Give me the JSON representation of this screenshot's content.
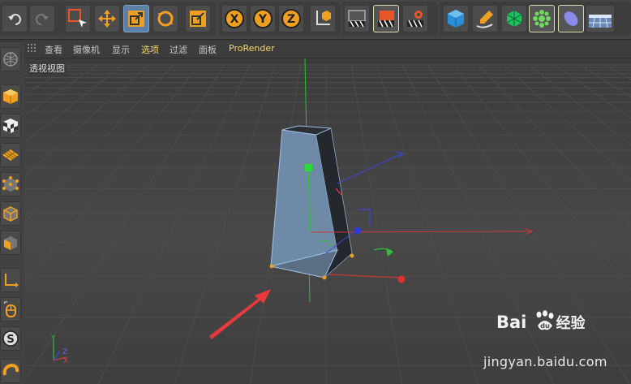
{
  "toolbar": {
    "axis_x": "X",
    "axis_y": "Y",
    "axis_z": "Z",
    "items": [
      "undo-icon",
      "redo-icon",
      "live-selection-icon",
      "move-icon",
      "scale-icon",
      "rotate-icon",
      "recent-tool-icon",
      "lock-x-icon",
      "lock-y-icon",
      "lock-z-icon",
      "coordinate-system-icon",
      "render-view-icon",
      "render-to-picture-viewer-icon",
      "render-settings-icon",
      "cube-icon",
      "pen-icon",
      "subdivision-icon",
      "cloner-icon",
      "deformer-icon",
      "floor-icon"
    ]
  },
  "sidebar": {
    "items": [
      "make-editable-icon",
      "model-mode-icon",
      "texture-mode-icon",
      "workplane-icon",
      "points-mode-icon",
      "edges-mode-icon",
      "polygons-mode-icon",
      "axis-icon",
      "tweak-icon",
      "snap-icon",
      "magnet-icon"
    ]
  },
  "menu": {
    "items": [
      "查看",
      "摄像机",
      "显示",
      "选项",
      "过滤",
      "面板",
      "ProRender"
    ],
    "active_index": 3
  },
  "viewport": {
    "title": "透视视图",
    "axes_gizmo": {
      "x": "X",
      "y": "Y",
      "z": "Z"
    }
  },
  "watermark": {
    "logo_text": "Bai",
    "logo_text_2": "经验",
    "url": "jingyan.baidu.com"
  },
  "colors": {
    "toolbar_bg": "#444444",
    "viewport_bg": "#3a3a3a",
    "grid_line": "#4c4c4c",
    "axis_red": "#c63a3a",
    "axis_green": "#2fbf3a",
    "axis_blue": "#3a48d8",
    "selection": "#9fc0e8",
    "point_handle": "#e8a020",
    "annotation_arrow": "#e83a3a",
    "menu_highlight": "#f0d870"
  }
}
